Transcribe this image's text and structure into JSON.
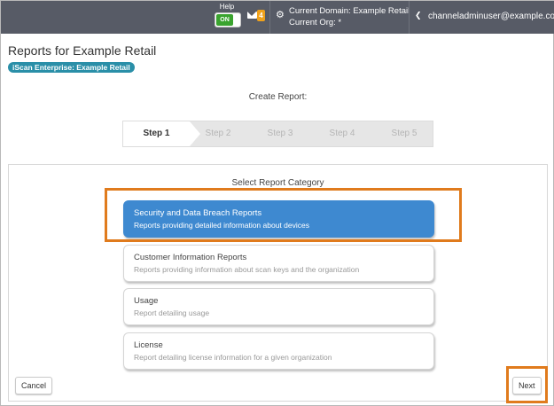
{
  "topbar": {
    "help_label": "Help",
    "help_toggle": "ON",
    "mail_count": "4",
    "current_domain": "Current Domain: Example Retail",
    "current_org": "Current Org: *",
    "user_email": "channeladminuser@example.com",
    "icons": [
      "mail-icon",
      "gear-icon",
      "chevron-down-icon"
    ]
  },
  "page": {
    "title": "Reports for Example Retail",
    "product_badge": "iScan Enterprise: Example Retail"
  },
  "wizard": {
    "heading": "Create Report:",
    "steps": [
      {
        "label": "Step 1",
        "active": true
      },
      {
        "label": "Step 2",
        "active": false
      },
      {
        "label": "Step 3",
        "active": false
      },
      {
        "label": "Step 4",
        "active": false
      },
      {
        "label": "Step 5",
        "active": false
      }
    ]
  },
  "categories": {
    "heading": "Select Report Category",
    "items": [
      {
        "title": "Security and Data Breach Reports",
        "description": "Reports providing detailed information about devices",
        "selected": true
      },
      {
        "title": "Customer Information Reports",
        "description": "Reports providing information about scan keys and the organization",
        "selected": false
      },
      {
        "title": "Usage",
        "description": "Report detailing usage",
        "selected": false
      },
      {
        "title": "License",
        "description": "Report detailing license information for a given organization",
        "selected": false
      }
    ]
  },
  "buttons": {
    "cancel": "Cancel",
    "next": "Next"
  },
  "colors": {
    "topbar": "#575b66",
    "selected_card": "#3e89d0",
    "highlight": "#e07b1d",
    "toggle_on": "#3aa32f",
    "badge": "#2a8fa8"
  }
}
